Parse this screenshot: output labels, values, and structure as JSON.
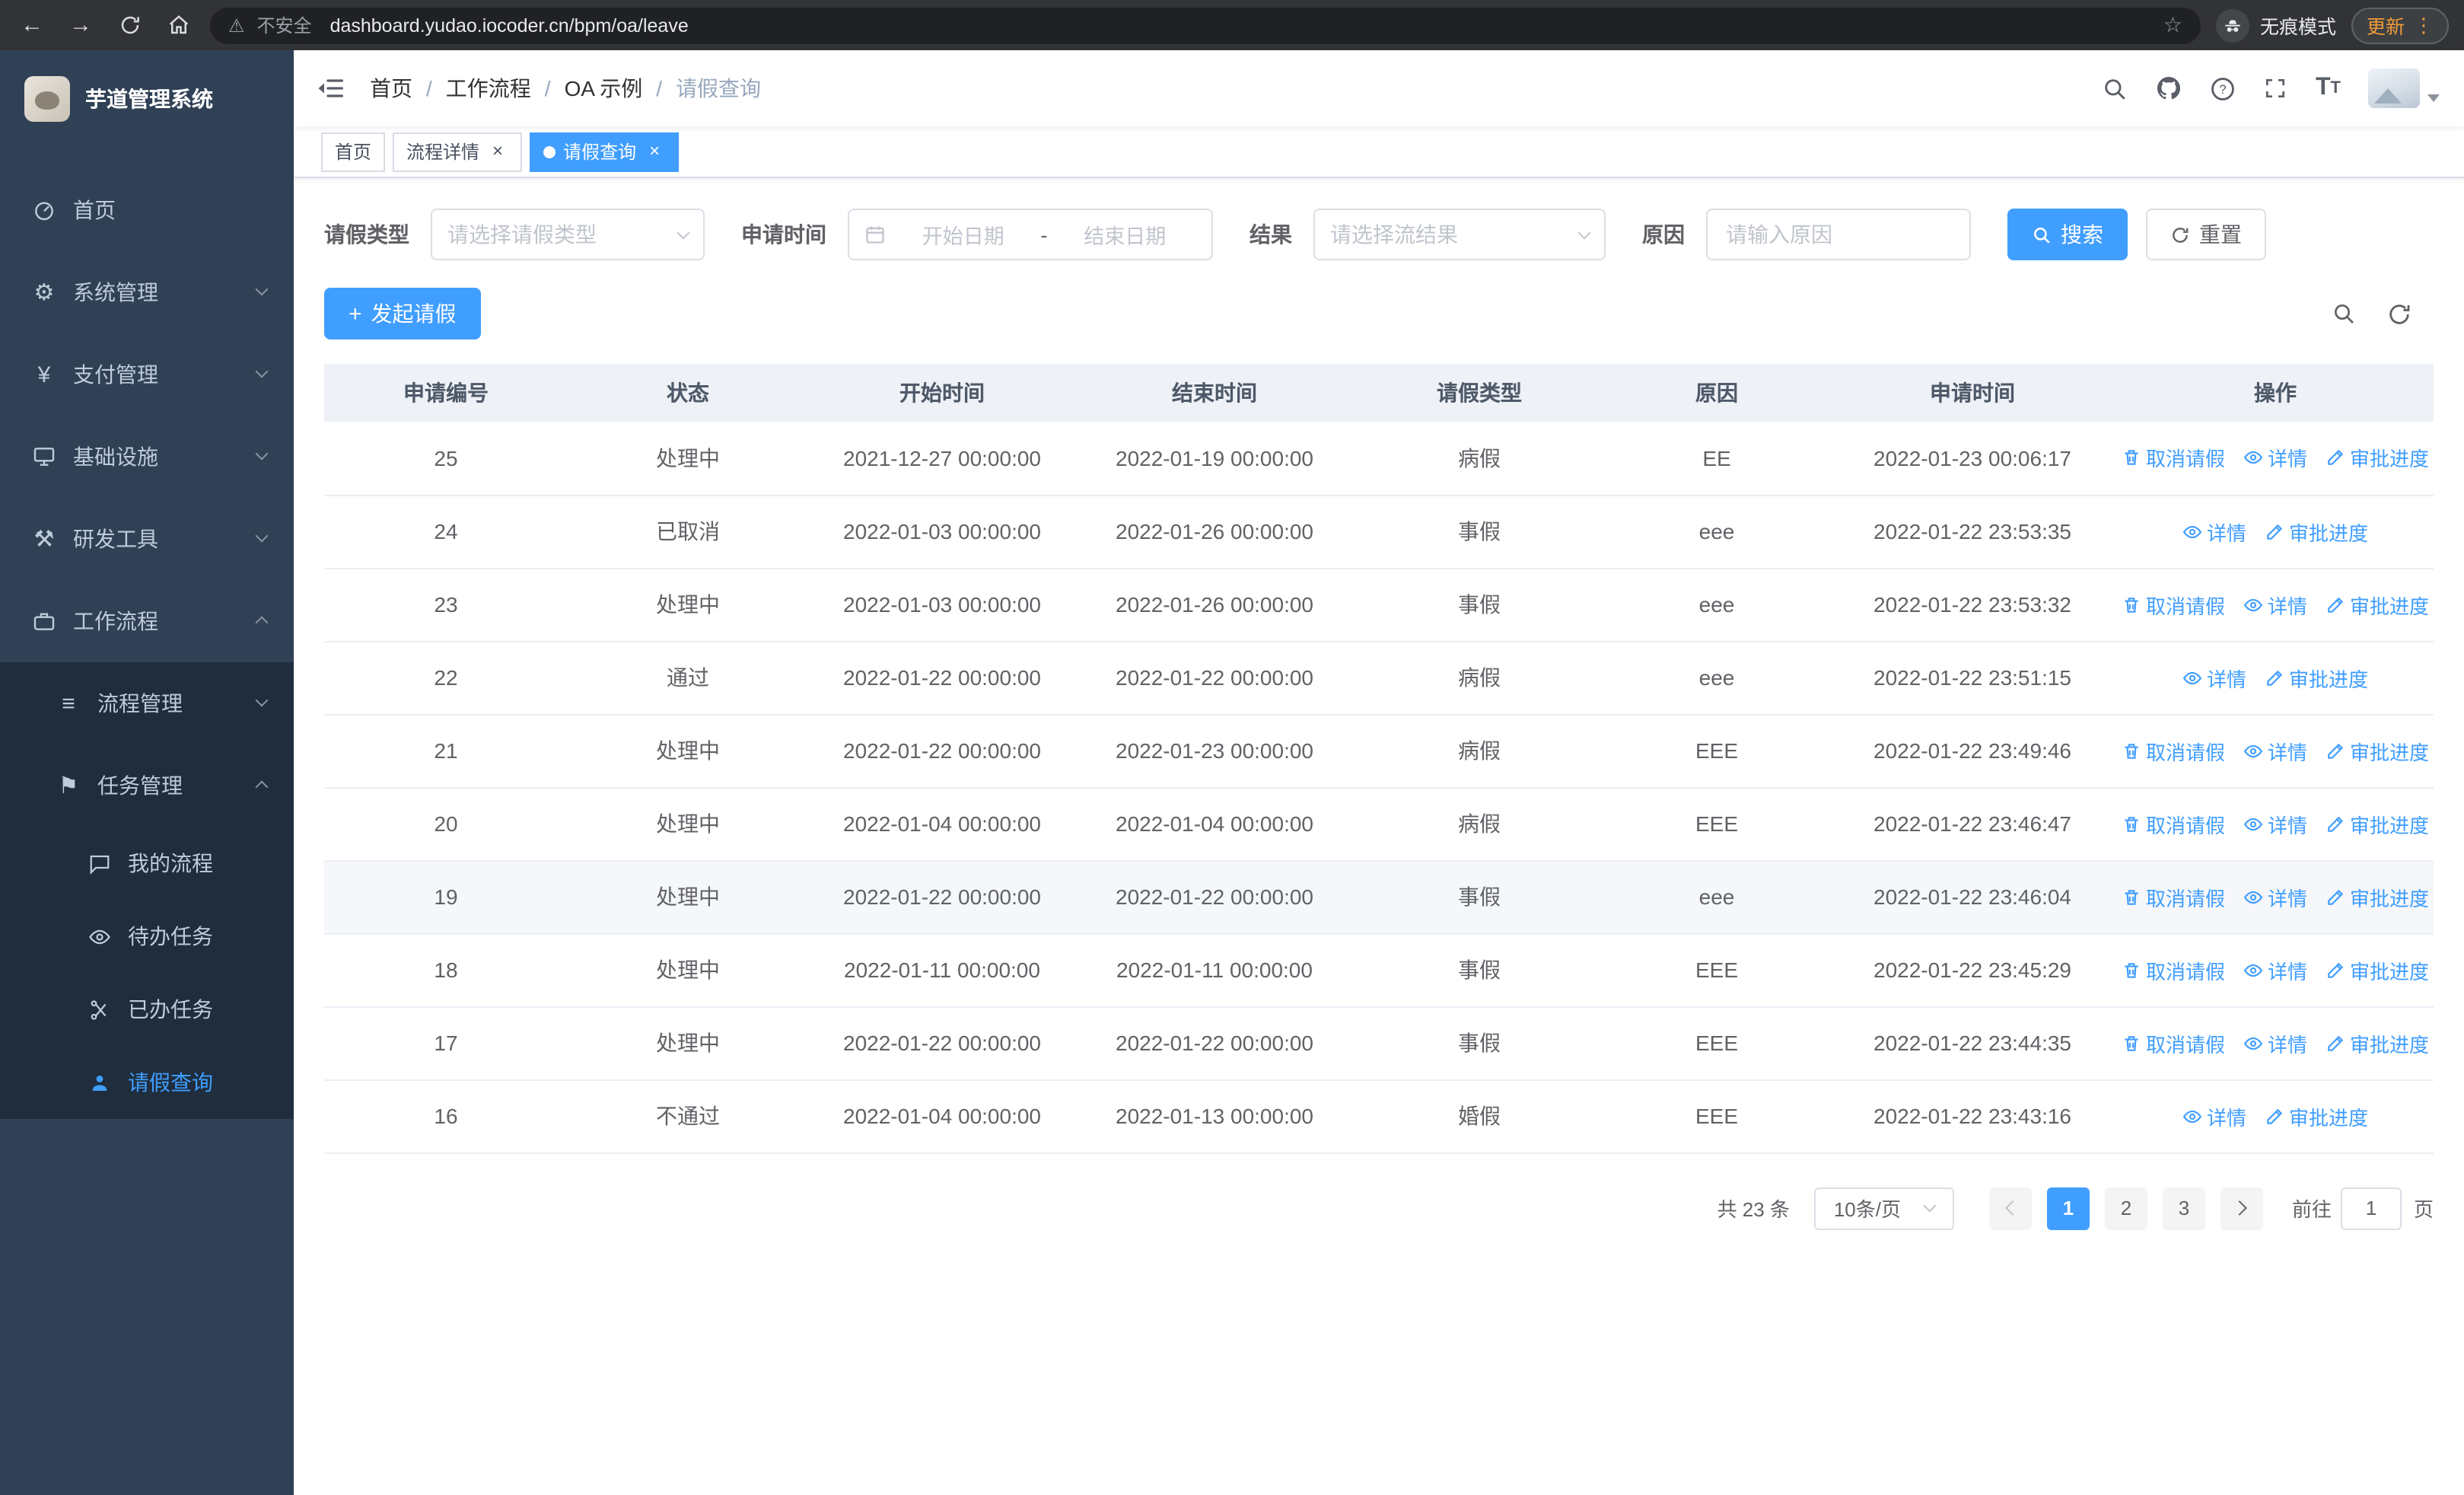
{
  "icons": {
    "back": "←",
    "forward": "→",
    "warning": "⚠",
    "star": "☆",
    "dots": "⋮",
    "close": "×",
    "plus": "+",
    "gear": "⚙",
    "yen": "¥",
    "hammer": "⚒",
    "list": "≡",
    "flag": "⚑"
  },
  "browser": {
    "security_label": "不安全",
    "url": "dashboard.yudao.iocoder.cn/bpm/oa/leave",
    "incognito_label": "无痕模式",
    "update_label": "更新"
  },
  "sidebar": {
    "title": "芋道管理系统",
    "items": [
      {
        "label": "首页"
      },
      {
        "label": "系统管理"
      },
      {
        "label": "支付管理"
      },
      {
        "label": "基础设施"
      },
      {
        "label": "研发工具"
      },
      {
        "label": "工作流程"
      }
    ],
    "workflow_children": [
      {
        "label": "流程管理"
      },
      {
        "label": "任务管理"
      }
    ],
    "task_children": [
      {
        "label": "我的流程"
      },
      {
        "label": "待办任务"
      },
      {
        "label": "已办任务"
      },
      {
        "label": "请假查询"
      }
    ]
  },
  "navbar": {
    "breadcrumb": [
      "首页",
      "工作流程",
      "OA 示例",
      "请假查询"
    ]
  },
  "tabs": [
    {
      "label": "首页"
    },
    {
      "label": "流程详情"
    },
    {
      "label": "请假查询"
    }
  ],
  "filters": {
    "leave_type_label": "请假类型",
    "leave_type_placeholder": "请选择请假类型",
    "apply_time_label": "申请时间",
    "start_placeholder": "开始日期",
    "range_separator": "-",
    "end_placeholder": "结束日期",
    "result_label": "结果",
    "result_placeholder": "请选择流结果",
    "reason_label": "原因",
    "reason_placeholder": "请输入原因",
    "search_label": "搜索",
    "reset_label": "重置"
  },
  "toolbar": {
    "create_label": "发起请假"
  },
  "table": {
    "headers": [
      "申请编号",
      "状态",
      "开始时间",
      "结束时间",
      "请假类型",
      "原因",
      "申请时间",
      "操作"
    ],
    "action_labels": {
      "cancel": "取消请假",
      "detail": "详情",
      "progress": "审批进度"
    },
    "rows": [
      {
        "id": "25",
        "status": "处理中",
        "start": "2021-12-27 00:00:00",
        "end": "2022-01-19 00:00:00",
        "type": "病假",
        "reason": "EE",
        "applied": "2022-01-23 00:06:17",
        "actions": [
          "cancel",
          "detail",
          "progress"
        ]
      },
      {
        "id": "24",
        "status": "已取消",
        "start": "2022-01-03 00:00:00",
        "end": "2022-01-26 00:00:00",
        "type": "事假",
        "reason": "eee",
        "applied": "2022-01-22 23:53:35",
        "actions": [
          "detail",
          "progress"
        ]
      },
      {
        "id": "23",
        "status": "处理中",
        "start": "2022-01-03 00:00:00",
        "end": "2022-01-26 00:00:00",
        "type": "事假",
        "reason": "eee",
        "applied": "2022-01-22 23:53:32",
        "actions": [
          "cancel",
          "detail",
          "progress"
        ]
      },
      {
        "id": "22",
        "status": "通过",
        "start": "2022-01-22 00:00:00",
        "end": "2022-01-22 00:00:00",
        "type": "病假",
        "reason": "eee",
        "applied": "2022-01-22 23:51:15",
        "actions": [
          "detail",
          "progress"
        ]
      },
      {
        "id": "21",
        "status": "处理中",
        "start": "2022-01-22 00:00:00",
        "end": "2022-01-23 00:00:00",
        "type": "病假",
        "reason": "EEE",
        "applied": "2022-01-22 23:49:46",
        "actions": [
          "cancel",
          "detail",
          "progress"
        ]
      },
      {
        "id": "20",
        "status": "处理中",
        "start": "2022-01-04 00:00:00",
        "end": "2022-01-04 00:00:00",
        "type": "病假",
        "reason": "EEE",
        "applied": "2022-01-22 23:46:47",
        "actions": [
          "cancel",
          "detail",
          "progress"
        ]
      },
      {
        "id": "19",
        "status": "处理中",
        "start": "2022-01-22 00:00:00",
        "end": "2022-01-22 00:00:00",
        "type": "事假",
        "reason": "eee",
        "applied": "2022-01-22 23:46:04",
        "actions": [
          "cancel",
          "detail",
          "progress"
        ],
        "hover": true
      },
      {
        "id": "18",
        "status": "处理中",
        "start": "2022-01-11 00:00:00",
        "end": "2022-01-11 00:00:00",
        "type": "事假",
        "reason": "EEE",
        "applied": "2022-01-22 23:45:29",
        "actions": [
          "cancel",
          "detail",
          "progress"
        ]
      },
      {
        "id": "17",
        "status": "处理中",
        "start": "2022-01-22 00:00:00",
        "end": "2022-01-22 00:00:00",
        "type": "事假",
        "reason": "EEE",
        "applied": "2022-01-22 23:44:35",
        "actions": [
          "cancel",
          "detail",
          "progress"
        ]
      },
      {
        "id": "16",
        "status": "不通过",
        "start": "2022-01-04 00:00:00",
        "end": "2022-01-13 00:00:00",
        "type": "婚假",
        "reason": "EEE",
        "applied": "2022-01-22 23:43:16",
        "actions": [
          "detail",
          "progress"
        ]
      }
    ]
  },
  "pagination": {
    "total_label": "共 23 条",
    "page_size": "10条/页",
    "pages": [
      "1",
      "2",
      "3"
    ],
    "active_page": "1",
    "goto_label": "前往",
    "goto_value": "1",
    "page_unit": "页"
  },
  "colors": {
    "accent": "#409eff",
    "sidebar_bg": "#304156",
    "submenu_bg": "#1f2d3d"
  }
}
